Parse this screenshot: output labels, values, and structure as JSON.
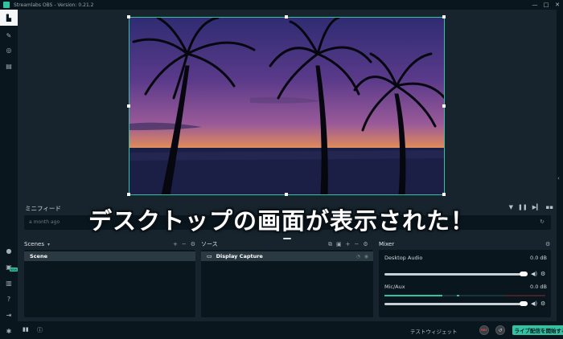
{
  "window": {
    "title": "Streamlabs OBS - Version: 0.21.2",
    "controls": [
      "—",
      "□",
      "✕"
    ]
  },
  "sidebar": {
    "top_items": [
      {
        "name": "editor",
        "icon": "editor-icon",
        "glyph": "▙"
      },
      {
        "name": "themes",
        "icon": "wrench-icon",
        "glyph": "✎"
      },
      {
        "name": "dashboard",
        "icon": "globe-icon",
        "glyph": "◎"
      },
      {
        "name": "store",
        "icon": "store-icon",
        "glyph": "▤"
      }
    ],
    "bottom_items": [
      {
        "name": "highlighter",
        "icon": "circle-icon",
        "glyph": "●"
      },
      {
        "name": "app-store",
        "icon": "apps-icon",
        "glyph": "▣"
      },
      {
        "name": "layout",
        "icon": "layout-icon",
        "glyph": "▥"
      },
      {
        "name": "help",
        "icon": "help-icon",
        "glyph": "?"
      },
      {
        "name": "login",
        "icon": "login-icon",
        "glyph": "⇥"
      },
      {
        "name": "settings",
        "icon": "gear-icon",
        "glyph": "✱"
      }
    ],
    "new_badge": "NEW"
  },
  "minifeed": {
    "title": "ミニフィード",
    "feed_text": "a month ago",
    "controls": [
      "▼",
      "❚❚",
      "▶▎",
      "▪▪"
    ]
  },
  "overlay_caption": "デスクトップの画面が表示された！",
  "scenes": {
    "title": "Scenes",
    "items": [
      "Scene"
    ],
    "tools": [
      "+",
      "−",
      "⚙"
    ]
  },
  "sources": {
    "title": "ソース",
    "items": [
      "Display Capture"
    ],
    "tools": [
      "⧉",
      "▣",
      "+",
      "−",
      "⚙"
    ]
  },
  "mixer": {
    "title": "Mixer",
    "items": [
      {
        "name": "Desktop Audio",
        "db": "0.0 dB",
        "volume": 1.0
      },
      {
        "name": "Mic/Aux",
        "db": "0.0 dB",
        "volume": 1.0
      }
    ]
  },
  "footer": {
    "test_widgets": "テストウィジェット",
    "rec_label": "REC",
    "go_live": "ライブ配信を開始する"
  },
  "colors": {
    "accent": "#31c3a2",
    "background": "#17242d",
    "panel": "#09161d"
  }
}
